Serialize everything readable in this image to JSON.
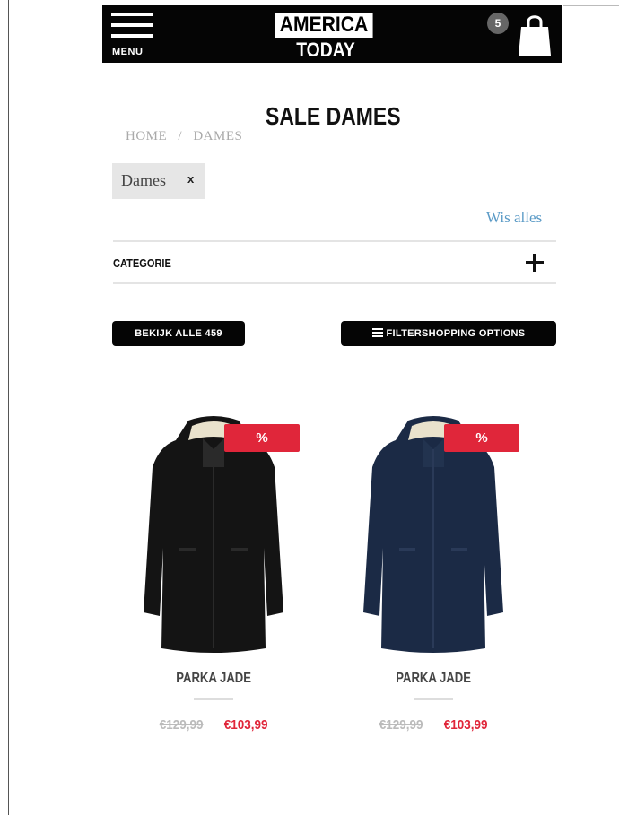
{
  "header": {
    "menu_label": "MENU",
    "logo_line1": "AMERICA",
    "logo_line2": "TODAY",
    "cart_count": "5",
    "icons": [
      "menu-icon",
      "shopping-bag-icon"
    ]
  },
  "breadcrumb": {
    "home": "HOME",
    "separator": "/",
    "current": "DAMES"
  },
  "page_title": "SALE DAMES",
  "active_filter": {
    "label": "Dames",
    "remove": "x"
  },
  "clear_all": "Wis alles",
  "category": {
    "label": "CATEGORIE",
    "toggle_icon": "plus-icon"
  },
  "actions": {
    "view_all": "BEKIJK ALLE 459",
    "filter_options": "FILTERSHOPPING OPTIONS"
  },
  "products": [
    {
      "badge": "%",
      "name": "PARKA JADE",
      "old_price": "€129,99",
      "new_price": "€103,99",
      "color": "#141414"
    },
    {
      "badge": "%",
      "name": "PARKA JADE",
      "old_price": "€129,99",
      "new_price": "€103,99",
      "color": "#1b2a45"
    }
  ],
  "colors": {
    "header_bg": "#050505",
    "sale_red": "#e0263a",
    "link_blue": "#5a9ac6"
  }
}
